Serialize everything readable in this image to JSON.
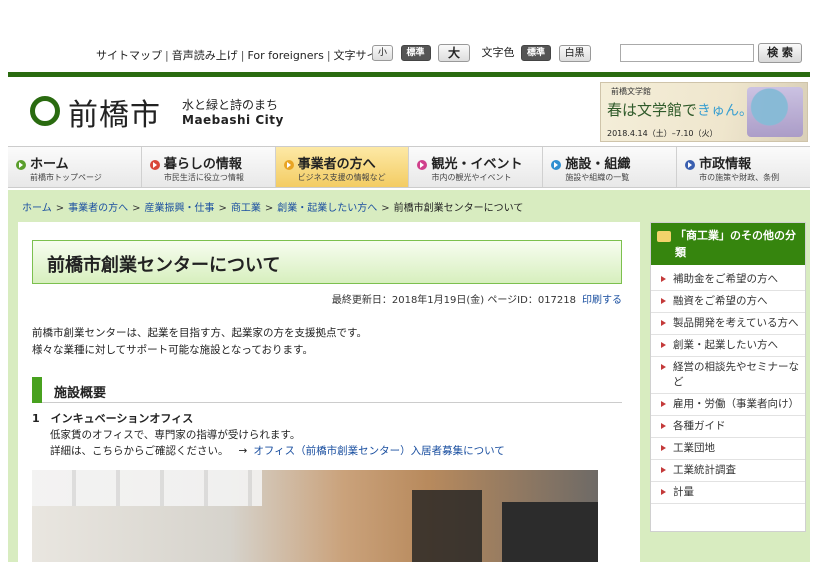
{
  "utility": {
    "links": [
      "サイトマップ",
      "音声読み上げ",
      "For foreigners"
    ],
    "font_size_label": "文字サイズ",
    "font_size_small": "小",
    "font_size_standard": "標準",
    "font_size_large": "大",
    "color_label": "文字色",
    "color_standard": "標準",
    "color_white_black": "白黒",
    "search_placeholder": "",
    "search_button": "検 索"
  },
  "logo": {
    "kanji": "前橋市",
    "tagline": "水と緑と詩のまち",
    "city": "Maebashi City"
  },
  "banner": {
    "brand": "前橋文学館",
    "main": "春は文学館で",
    "kyun": "きゅん。",
    "dates": "2018.4.14（土）–7.10（火）"
  },
  "nav": [
    {
      "title": "ホーム",
      "sub": "前橋市トップページ",
      "color": "#5a9e2c"
    },
    {
      "title": "暮らしの情報",
      "sub": "市民生活に役立つ情報",
      "color": "#d9473a"
    },
    {
      "title": "事業者の方へ",
      "sub": "ビジネス支援の情報など",
      "color": "#e8a424"
    },
    {
      "title": "観光・イベント",
      "sub": "市内の観光やイベント",
      "color": "#d0408c"
    },
    {
      "title": "施設・組織",
      "sub": "施設や組織の一覧",
      "color": "#2f8fd0"
    },
    {
      "title": "市政情報",
      "sub": "市の施策や財政、条例",
      "color": "#3a5fb0"
    }
  ],
  "breadcrumb": {
    "items": [
      "ホーム",
      "事業者の方へ",
      "産業振興・仕事",
      "商工業",
      "創業・起業したい方へ"
    ],
    "current": "前橋市創業センターについて"
  },
  "main": {
    "title": "前橋市創業センターについて",
    "updated": "最終更新日：2018年1月19日(金) ページID：017218",
    "print": "印刷する",
    "intro_line1": "前橋市創業センターは、起業を目指す方、起業家の方を支援拠点です。",
    "intro_line2": "様々な業種に対してサポート可能な施設となっております。",
    "section_title": "施設概要",
    "item_heading": "1　インキュベーションオフィス",
    "item_line1": "低家賃のオフィスで、専門家の指導が受けられます。",
    "item_line2": "詳細は、こちらからご確認ください。",
    "item_arrow": "→",
    "item_link": "オフィス（前橋市創業センター）入居者募集について"
  },
  "sidebar": {
    "heading": "「商工業」のその他の分類",
    "items": [
      "補助金をご希望の方へ",
      "融資をご希望の方へ",
      "製品開発を考えている方へ",
      "創業・起業したい方へ",
      "経営の相談先やセミナーなど",
      "雇用・労働（事業者向け）",
      "各種ガイド",
      "工業団地",
      "工業統計調査",
      "計量"
    ]
  }
}
